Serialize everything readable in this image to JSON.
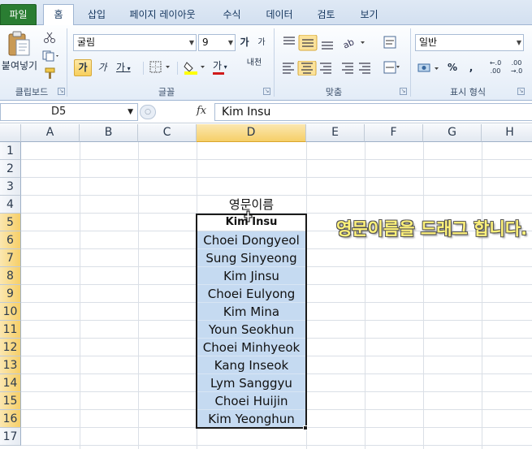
{
  "ribbon": {
    "tabs": [
      "파일",
      "홈",
      "삽입",
      "페이지 레이아웃",
      "수식",
      "데이터",
      "검토",
      "보기"
    ],
    "clipboard": {
      "paste_label": "붙여넣기",
      "group_label": "클립보드"
    },
    "font": {
      "name": "굴림",
      "size": "9",
      "group_label": "글꼴",
      "bold": "가",
      "italic": "가",
      "underline": "가",
      "grow": "가",
      "shrink": "가",
      "font_color_letter": "가",
      "wrap": "내천"
    },
    "alignment": {
      "group_label": "맞춤"
    },
    "number": {
      "format": "일반",
      "group_label": "표시 형식",
      "percent": "%",
      "comma": ",",
      "inc_decimal": "←.0\n.00",
      "dec_decimal": ".00\n→.0"
    }
  },
  "formula_bar": {
    "name_box": "D5",
    "fx": "fx",
    "content": "Kim Insu"
  },
  "grid": {
    "columns": [
      "A",
      "B",
      "C",
      "D",
      "E",
      "F",
      "G",
      "H"
    ],
    "rows": [
      "1",
      "2",
      "3",
      "4",
      "5",
      "6",
      "7",
      "8",
      "9",
      "10",
      "11",
      "12",
      "13",
      "14",
      "15",
      "16",
      "17"
    ],
    "selected_column": "D",
    "header_cell": "영문이름",
    "names": [
      "Kim Insu",
      "Choei Dongyeol",
      "Sung Sinyeong",
      "Kim Jinsu",
      "Choei Eulyong",
      "Kim Mina",
      "Youn Seokhun",
      "Choei Minhyeok",
      "Kang Inseok",
      "Lym Sanggyu",
      "Choei Huijin",
      "Kim Yeonghun"
    ]
  },
  "annotation": "영문이름을 드래그 합니다.",
  "colors": {
    "file_tab": "#2a7d32",
    "selection_fill": "#c5daf1",
    "header_highlight": "#f6cf68",
    "annotation": "#fff27a"
  }
}
